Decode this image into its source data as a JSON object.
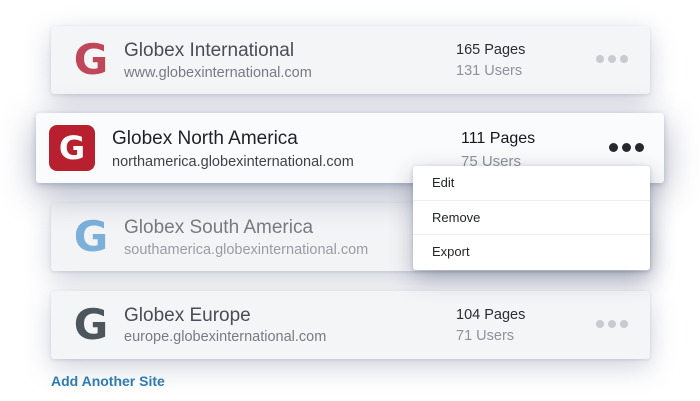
{
  "colors": {
    "globex_international_logo": "#c0475a",
    "globex_north_america_tile": "#b8202f",
    "globex_south_america_logo": "#4f97cf",
    "globex_europe_logo": "#4c565c",
    "link": "#2e7bb3"
  },
  "sites": [
    {
      "logo_letter": "G",
      "name": "Globex International",
      "url": "www.globexinternational.com",
      "pages": "165 Pages",
      "users": "131 Users"
    },
    {
      "logo_letter": "G",
      "name": "Globex North America",
      "url": "northamerica.globexinternational.com",
      "pages": "111 Pages",
      "users": "75 Users"
    },
    {
      "logo_letter": "G",
      "name": "Globex South America",
      "url": "southamerica.globexinternational.com",
      "pages": "",
      "users": ""
    },
    {
      "logo_letter": "G",
      "name": "Globex Europe",
      "url": "europe.globexinternational.com",
      "pages": "104 Pages",
      "users": "71 Users"
    }
  ],
  "context_menu": {
    "items": [
      "Edit",
      "Remove",
      "Export"
    ]
  },
  "add_site_label": "Add Another Site",
  "icons": {
    "more": "more-horizontal-icon",
    "logo": "globex-g-logo-icon"
  }
}
